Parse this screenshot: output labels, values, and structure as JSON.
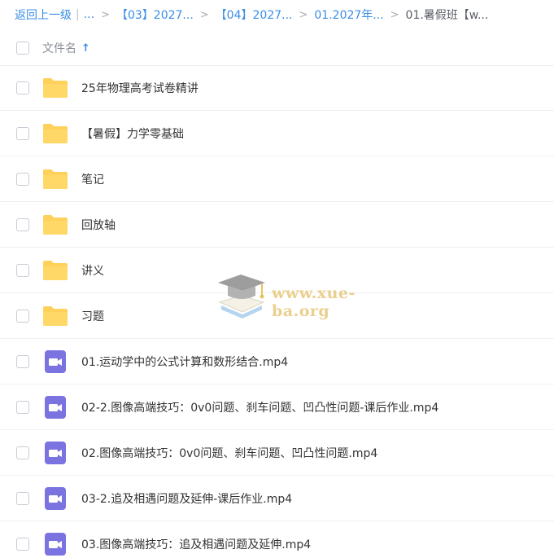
{
  "breadcrumb": {
    "back_label": "返回上一级",
    "pipe": "|",
    "ellipsis": "...",
    "separator": ">",
    "items": [
      "【03】2027...",
      "【04】2027...",
      "01.2027年..."
    ],
    "current": "01.暑假班【w..."
  },
  "header": {
    "column_label": "文件名",
    "sort_icon": "arrow-up-icon",
    "sort_glyph": "↑"
  },
  "rows": [
    {
      "type": "folder",
      "name": "25年物理高考试卷精讲"
    },
    {
      "type": "folder",
      "name": "【暑假】力学零基础"
    },
    {
      "type": "folder",
      "name": "笔记"
    },
    {
      "type": "folder",
      "name": "回放轴"
    },
    {
      "type": "folder",
      "name": "讲义"
    },
    {
      "type": "folder",
      "name": "习题"
    },
    {
      "type": "video",
      "name": "01.运动学中的公式计算和数形结合.mp4"
    },
    {
      "type": "video",
      "name": "02-2.图像高端技巧：0v0问题、刹车问题、凹凸性问题-课后作业.mp4"
    },
    {
      "type": "video",
      "name": "02.图像高端技巧：0v0问题、刹车问题、凹凸性问题.mp4"
    },
    {
      "type": "video",
      "name": "03-2.追及相遇问题及延伸-课后作业.mp4"
    },
    {
      "type": "video",
      "name": "03.图像高端技巧：追及相遇问题及延伸.mp4"
    }
  ],
  "watermark": {
    "text": "www.xue-ba.org"
  },
  "colors": {
    "link": "#3a8ee6",
    "folder": "#ffd05a",
    "video": "#7b74e0"
  }
}
